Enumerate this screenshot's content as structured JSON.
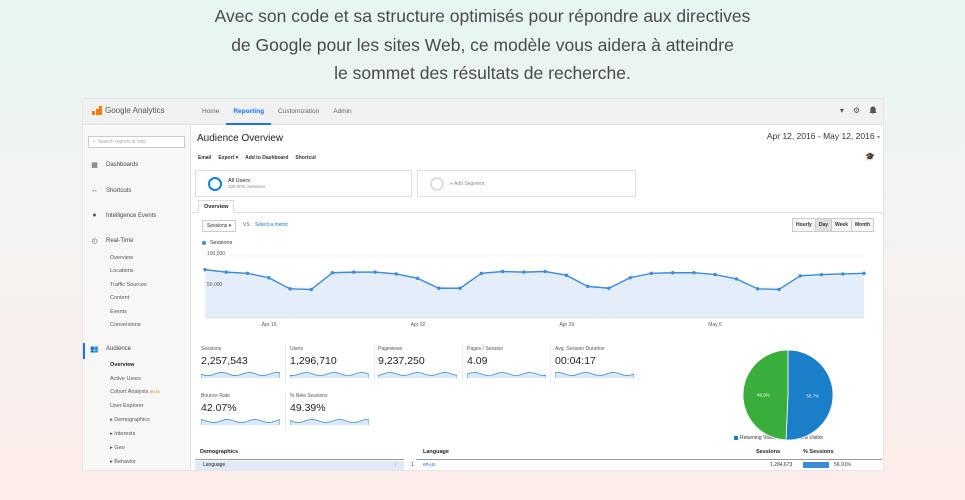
{
  "headline": {
    "line1": "Avec son code et sa structure optimisés pour répondre aux directives",
    "line2": "de Google pour les sites Web, ce modèle vous aidera à atteindre",
    "line3": "le sommet des résultats de recherche."
  },
  "app": {
    "logo_text": "Google Analytics",
    "nav_tabs": [
      "Home",
      "Reporting",
      "Customization",
      "Admin"
    ],
    "active_tab": "Reporting",
    "top_icons": [
      "caret-down-icon",
      "gear-icon",
      "bell-icon"
    ]
  },
  "sidebar": {
    "search_placeholder": "Search reports & help",
    "items": [
      {
        "label": "Dashboards",
        "icon": "grid-icon"
      },
      {
        "label": "Shortcuts",
        "icon": "arrows-icon"
      },
      {
        "label": "Intelligence Events",
        "icon": "bulb-icon"
      },
      {
        "label": "Real-Time",
        "icon": "clock-icon"
      },
      {
        "label": "Audience",
        "icon": "people-icon"
      }
    ],
    "realtime_sub": [
      "Overview",
      "Locations",
      "Traffic Sources",
      "Content",
      "Events",
      "Conversions"
    ],
    "audience_sub": [
      "Overview",
      "Active Users",
      "Cohort Analysis",
      "User Explorer",
      "Demographics",
      "Interests",
      "Geo",
      "Behavior"
    ],
    "beta_label": "BETA"
  },
  "report": {
    "title": "Audience Overview",
    "date_range": "Apr 12, 2016 - May 12, 2016",
    "actions": [
      "Email",
      "Export ▾",
      "Add to Dashboard",
      "Shortcut"
    ],
    "segment_all_users": "All Users",
    "segment_all_users_sub": "100.00% Sessions",
    "segment_add": "+ Add Segment",
    "overview_tab": "Overview",
    "metric_select": "Sessions ▾",
    "vs_text": "VS",
    "select_metric": "Select a metric",
    "granularity": [
      "Hourly",
      "Day",
      "Week",
      "Month"
    ],
    "granularity_active": "Day",
    "series_label": "Sessions"
  },
  "chart_data": {
    "type": "area",
    "series": [
      {
        "name": "Sessions",
        "values": [
          78000,
          74000,
          72000,
          65000,
          47000,
          46000,
          73000,
          74000,
          74000,
          71000,
          64000,
          48000,
          48000,
          72000,
          75000,
          74000,
          75000,
          69000,
          51000,
          48000,
          65000,
          72000,
          73000,
          73000,
          70000,
          63000,
          47000,
          46000,
          68000,
          70000,
          71000,
          72000
        ]
      }
    ],
    "x_tick_labels": [
      "Apr 15",
      "Apr 22",
      "Apr 29",
      "May 6"
    ],
    "y_tick_labels": [
      "100,000",
      "50,000"
    ],
    "ylim": [
      0,
      100000
    ],
    "color": "#3d8bd6",
    "grid": true
  },
  "metrics": [
    {
      "label": "Sessions",
      "value": "2,257,543"
    },
    {
      "label": "Users",
      "value": "1,296,710"
    },
    {
      "label": "Pageviews",
      "value": "9,237,250"
    },
    {
      "label": "Pages / Session",
      "value": "4.09"
    },
    {
      "label": "Avg. Session Duration",
      "value": "00:04:17"
    },
    {
      "label": "Bounce Rate",
      "value": "42.07%"
    },
    {
      "label": "% New Sessions",
      "value": "49.39%"
    }
  ],
  "pie": {
    "legend": [
      {
        "label": "Returning Visitor",
        "color": "#1a7ec8"
      },
      {
        "label": "New Visitor",
        "color": "#3aae3a"
      }
    ],
    "slices": [
      {
        "label": "Returning Visitor",
        "value": 50.7,
        "text": "50.7%"
      },
      {
        "label": "New Visitor",
        "value": 49.3,
        "text": "49.3%"
      }
    ]
  },
  "bottom": {
    "demographics_header": "Demographics",
    "language_row": "Language",
    "language_header": "Language",
    "sessions_header": "Sessions",
    "pct_sessions_header": "% Sessions",
    "row_index": "1.",
    "row_lang": "en-us",
    "row_sessions": "1,284,673",
    "row_pct": "56.91%"
  }
}
